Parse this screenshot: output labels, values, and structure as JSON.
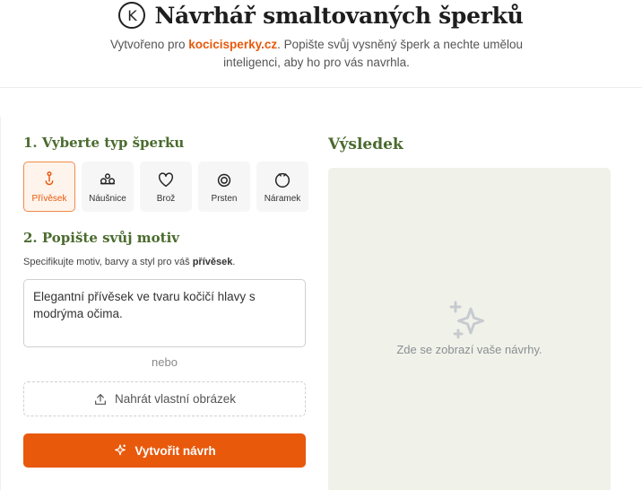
{
  "header": {
    "logo_letter": "K",
    "title": "Návrhář smaltovaných šperků",
    "subtitle_prefix": "Vytvořeno pro ",
    "brand": "kocicisperky.cz",
    "subtitle_suffix": ". Popište svůj vysněný šperk a nechte umělou inteligenci, aby ho pro vás navrhla."
  },
  "step1": {
    "title": "1. Vyberte typ šperku",
    "types": [
      {
        "label": "Přívěsek",
        "icon": "pendant-icon",
        "selected": true
      },
      {
        "label": "Náušnice",
        "icon": "earrings-icon",
        "selected": false
      },
      {
        "label": "Brož",
        "icon": "brooch-heart-icon",
        "selected": false
      },
      {
        "label": "Prsten",
        "icon": "ring-icon",
        "selected": false
      },
      {
        "label": "Náramek",
        "icon": "bracelet-icon",
        "selected": false
      }
    ]
  },
  "step2": {
    "title": "2. Popište svůj motiv",
    "hint_prefix": "Specifikujte motiv, barvy a styl pro váš ",
    "hint_bold": "přívěsek",
    "hint_suffix": ".",
    "textarea_value": "Elegantní přívěsek ve tvaru kočičí hlavy s modrýma očima.",
    "or_label": "nebo",
    "upload_label": "Nahrát vlastní obrázek",
    "create_label": "Vytvořit návrh"
  },
  "result": {
    "title": "Výsledek",
    "placeholder": "Zde se zobrazí vaše návrhy."
  },
  "colors": {
    "accent": "#e8590c",
    "heading_green": "#4a6b2e",
    "result_bg": "#f0f2ea"
  }
}
